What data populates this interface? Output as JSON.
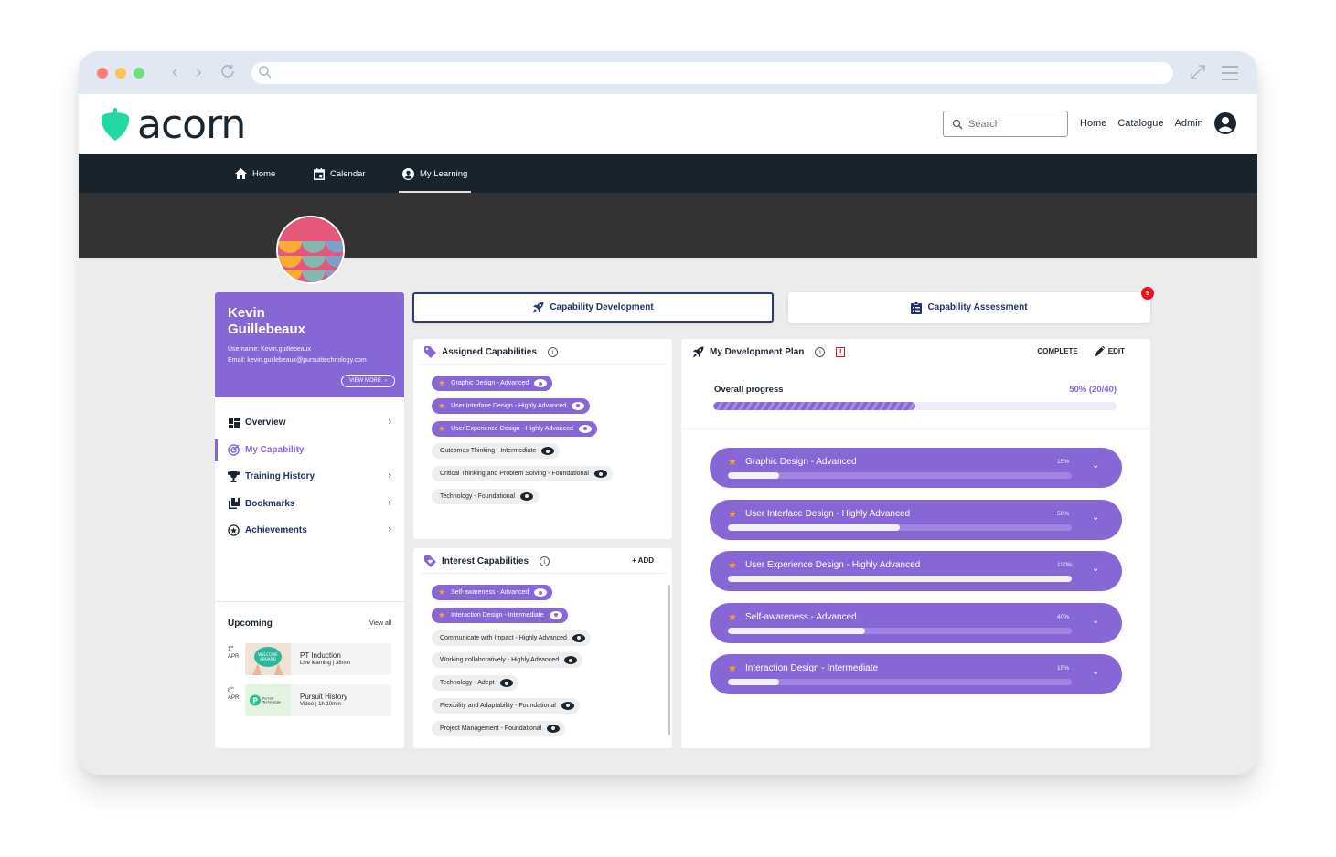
{
  "browser": {
    "url": ""
  },
  "brand": {
    "name": "acorn",
    "logo_color": "#22d9a3"
  },
  "header": {
    "search_placeholder": "Search",
    "links": [
      "Home",
      "Catalogue",
      "Admin"
    ]
  },
  "nav": {
    "items": [
      {
        "label": "Home",
        "icon": "home-icon"
      },
      {
        "label": "Calendar",
        "icon": "calendar-icon"
      },
      {
        "label": "My Learning",
        "icon": "account-circle-icon",
        "active": true
      }
    ]
  },
  "profile": {
    "name": "Kevin Guillebeaux",
    "username": "Username: Kevin.guillebeaux",
    "email": "Email: kevin.guillebeaux@pursuittechnology.com",
    "view_more": "VIEW MORE",
    "menu": [
      {
        "label": "Overview",
        "icon": "dashboard-icon"
      },
      {
        "label": "My Capability",
        "icon": "target-icon",
        "active": true
      },
      {
        "label": "Training History",
        "icon": "trophy-icon"
      },
      {
        "label": "Bookmarks",
        "icon": "bookmarks-icon"
      },
      {
        "label": "Achievements",
        "icon": "star-badge-icon"
      }
    ],
    "upcoming": {
      "title": "Upcoming",
      "view_all": "View all",
      "items": [
        {
          "day": "1",
          "suffix": "st",
          "month": "APR",
          "title": "PT Induction",
          "meta": "Live learning  |  38min",
          "thumb_text": "WELCOME ABOARD"
        },
        {
          "day": "8",
          "suffix": "th",
          "month": "APR",
          "title": "Pursuit History",
          "meta": "Video  |  1h 10min",
          "thumb_text": "Pursuit Technology"
        }
      ]
    }
  },
  "tabs": {
    "development": "Capability Development",
    "assessment": "Capability Assessment",
    "assessment_badge": "5"
  },
  "assigned": {
    "title": "Assigned Capabilities",
    "chips": [
      {
        "label": "Graphic Design - Advanced",
        "starred": true
      },
      {
        "label": "User Interface Design - Highly Advanced",
        "starred": true
      },
      {
        "label": "User Experience Design - Highly Advanced",
        "starred": true
      },
      {
        "label": "Outcomes Thinking - Intermediate",
        "starred": false
      },
      {
        "label": "Critical Thinking and Problem Solving - Foundational",
        "starred": false
      },
      {
        "label": "Technology - Foundational",
        "starred": false
      }
    ]
  },
  "interest": {
    "title": "Interest Capabilities",
    "add_label": "+ ADD",
    "chips": [
      {
        "label": "Self-awareness - Advanced",
        "starred": true
      },
      {
        "label": "Interaction Design - Intermediate",
        "starred": true
      },
      {
        "label": "Communicate with Impact - Highly Advanced",
        "starred": false
      },
      {
        "label": "Working collaboratively - Highly Advanced",
        "starred": false
      },
      {
        "label": "Technology - Adept",
        "starred": false
      },
      {
        "label": "Flexibility and Adaptability - Foundational",
        "starred": false
      },
      {
        "label": "Project Management - Foundational",
        "starred": false
      }
    ]
  },
  "plan": {
    "title": "My Development Plan",
    "complete_label": "COMPLETE",
    "edit_label": "EDIT",
    "overall_label": "Overall progress",
    "overall_value": "50% (20/40)",
    "overall_percent": 50,
    "goals": [
      {
        "label": "Graphic Design - Advanced",
        "percent_label": "15%",
        "percent": 15
      },
      {
        "label": "User Interface Design - Highly Advanced",
        "percent_label": "50%",
        "percent": 50
      },
      {
        "label": "User Experience Design - Highly Advanced",
        "percent_label": "100%",
        "percent": 100
      },
      {
        "label": "Self-awareness - Advanced",
        "percent_label": "40%",
        "percent": 40
      },
      {
        "label": "Interaction Design - Intermediate",
        "percent_label": "15%",
        "percent": 15
      }
    ]
  },
  "colors": {
    "accent": "#8766d6",
    "nav_bg": "#18232c",
    "star": "#f6a81d",
    "badge": "#e8141a"
  }
}
